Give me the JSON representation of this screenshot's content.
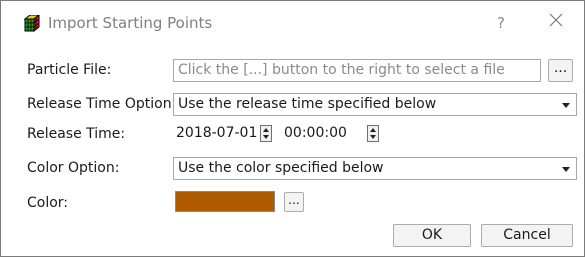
{
  "window": {
    "title": "Import Starting Points",
    "help_glyph": "?",
    "close_icon": "close-icon",
    "app_icon": "rubik-cube-icon"
  },
  "form": {
    "particle_file": {
      "label": "Particle File:",
      "placeholder": "Click the [...] button to the right to select a file",
      "browse_label": "..."
    },
    "release_time_option": {
      "label": "Release Time Option:",
      "value": "Use the release time specified below"
    },
    "release_time": {
      "label": "Release Time:",
      "date": "2018-07-01",
      "time": "00:00:00"
    },
    "color_option": {
      "label": "Color Option:",
      "value": "Use the color specified below"
    },
    "color": {
      "label": "Color:",
      "value": "#b05a00",
      "browse_label": "..."
    }
  },
  "buttons": {
    "ok": "OK",
    "cancel": "Cancel"
  }
}
